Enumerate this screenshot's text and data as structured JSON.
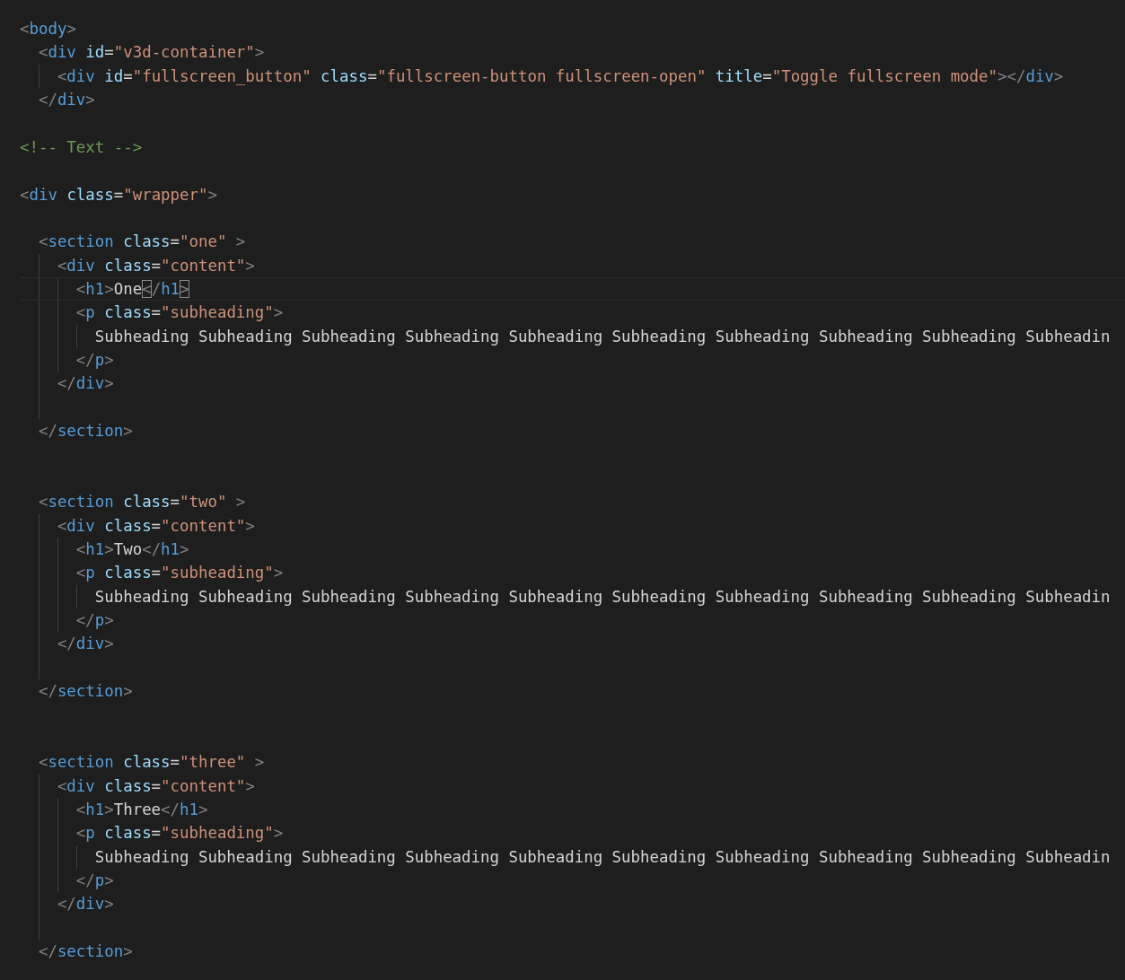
{
  "editor": {
    "lines": [
      {
        "kind": "code",
        "active": false,
        "tokens": [
          {
            "kind": "punct",
            "text": "<"
          },
          {
            "kind": "tag",
            "text": "body"
          },
          {
            "kind": "punct",
            "text": ">"
          }
        ]
      },
      {
        "kind": "code",
        "active": false,
        "tokens": [
          {
            "kind": "punct",
            "text": "  <"
          },
          {
            "kind": "tag",
            "text": "div"
          },
          {
            "kind": "attr",
            "text": " id"
          },
          {
            "kind": "text",
            "text": "="
          },
          {
            "kind": "string",
            "text": "\"v3d-container\""
          },
          {
            "kind": "punct",
            "text": ">"
          }
        ]
      },
      {
        "kind": "code",
        "active": false,
        "tokens": [
          {
            "kind": "punct",
            "text": "    <"
          },
          {
            "kind": "tag",
            "text": "div"
          },
          {
            "kind": "attr",
            "text": " id"
          },
          {
            "kind": "text",
            "text": "="
          },
          {
            "kind": "string",
            "text": "\"fullscreen_button\""
          },
          {
            "kind": "attr",
            "text": " class"
          },
          {
            "kind": "text",
            "text": "="
          },
          {
            "kind": "string",
            "text": "\"fullscreen-button fullscreen-open\""
          },
          {
            "kind": "attr",
            "text": " title"
          },
          {
            "kind": "text",
            "text": "="
          },
          {
            "kind": "string",
            "text": "\"Toggle fullscreen mode\""
          },
          {
            "kind": "punct",
            "text": "></"
          },
          {
            "kind": "tag",
            "text": "div"
          },
          {
            "kind": "punct",
            "text": ">"
          }
        ]
      },
      {
        "kind": "code",
        "active": false,
        "tokens": [
          {
            "kind": "punct",
            "text": "  </"
          },
          {
            "kind": "tag",
            "text": "div"
          },
          {
            "kind": "punct",
            "text": ">"
          }
        ]
      },
      {
        "kind": "blank",
        "active": false
      },
      {
        "kind": "code",
        "active": false,
        "tokens": [
          {
            "kind": "comment",
            "text": "<!-- Text -->"
          }
        ]
      },
      {
        "kind": "blank",
        "active": false
      },
      {
        "kind": "code",
        "active": false,
        "tokens": [
          {
            "kind": "punct",
            "text": "<"
          },
          {
            "kind": "tag",
            "text": "div"
          },
          {
            "kind": "attr",
            "text": " class"
          },
          {
            "kind": "text",
            "text": "="
          },
          {
            "kind": "string",
            "text": "\"wrapper\""
          },
          {
            "kind": "punct",
            "text": ">"
          }
        ]
      },
      {
        "kind": "blank",
        "active": false
      },
      {
        "kind": "code",
        "active": false,
        "tokens": [
          {
            "kind": "punct",
            "text": "  <"
          },
          {
            "kind": "tag",
            "text": "section"
          },
          {
            "kind": "attr",
            "text": " class"
          },
          {
            "kind": "text",
            "text": "="
          },
          {
            "kind": "string",
            "text": "\"one\""
          },
          {
            "kind": "punct",
            "text": " >"
          }
        ]
      },
      {
        "kind": "code",
        "active": false,
        "tokens": [
          {
            "kind": "punct",
            "text": "    <"
          },
          {
            "kind": "tag",
            "text": "div"
          },
          {
            "kind": "attr",
            "text": " class"
          },
          {
            "kind": "text",
            "text": "="
          },
          {
            "kind": "string",
            "text": "\"content\""
          },
          {
            "kind": "punct",
            "text": ">"
          }
        ]
      },
      {
        "kind": "code",
        "active": true,
        "tokens": [
          {
            "kind": "punct",
            "text": "      <"
          },
          {
            "kind": "tag",
            "text": "h1"
          },
          {
            "kind": "punct",
            "text": ">"
          },
          {
            "kind": "text",
            "text": "One"
          },
          {
            "kind": "bracket-match",
            "text": "<"
          },
          {
            "kind": "punct",
            "text": "/"
          },
          {
            "kind": "tag",
            "text": "h1"
          },
          {
            "kind": "bracket-match",
            "text": ">"
          }
        ]
      },
      {
        "kind": "code",
        "active": false,
        "tokens": [
          {
            "kind": "punct",
            "text": "      <"
          },
          {
            "kind": "tag",
            "text": "p"
          },
          {
            "kind": "attr",
            "text": " class"
          },
          {
            "kind": "text",
            "text": "="
          },
          {
            "kind": "string",
            "text": "\"subheading\""
          },
          {
            "kind": "punct",
            "text": ">"
          }
        ]
      },
      {
        "kind": "code",
        "active": false,
        "tokens": [
          {
            "kind": "text",
            "text": "        Subheading Subheading Subheading Subheading Subheading Subheading Subheading Subheading Subheading Subheadin"
          }
        ]
      },
      {
        "kind": "code",
        "active": false,
        "tokens": [
          {
            "kind": "punct",
            "text": "      </"
          },
          {
            "kind": "tag",
            "text": "p"
          },
          {
            "kind": "punct",
            "text": ">"
          }
        ]
      },
      {
        "kind": "code",
        "active": false,
        "tokens": [
          {
            "kind": "punct",
            "text": "    </"
          },
          {
            "kind": "tag",
            "text": "div"
          },
          {
            "kind": "punct",
            "text": ">"
          }
        ]
      },
      {
        "kind": "blank-guide",
        "active": false
      },
      {
        "kind": "code",
        "active": false,
        "tokens": [
          {
            "kind": "punct",
            "text": "  </"
          },
          {
            "kind": "tag",
            "text": "section"
          },
          {
            "kind": "punct",
            "text": ">"
          }
        ]
      },
      {
        "kind": "blank",
        "active": false
      },
      {
        "kind": "blank",
        "active": false
      },
      {
        "kind": "code",
        "active": false,
        "tokens": [
          {
            "kind": "punct",
            "text": "  <"
          },
          {
            "kind": "tag",
            "text": "section"
          },
          {
            "kind": "attr",
            "text": " class"
          },
          {
            "kind": "text",
            "text": "="
          },
          {
            "kind": "string",
            "text": "\"two\""
          },
          {
            "kind": "punct",
            "text": " >"
          }
        ]
      },
      {
        "kind": "code",
        "active": false,
        "tokens": [
          {
            "kind": "punct",
            "text": "    <"
          },
          {
            "kind": "tag",
            "text": "div"
          },
          {
            "kind": "attr",
            "text": " class"
          },
          {
            "kind": "text",
            "text": "="
          },
          {
            "kind": "string",
            "text": "\"content\""
          },
          {
            "kind": "punct",
            "text": ">"
          }
        ]
      },
      {
        "kind": "code",
        "active": false,
        "tokens": [
          {
            "kind": "punct",
            "text": "      <"
          },
          {
            "kind": "tag",
            "text": "h1"
          },
          {
            "kind": "punct",
            "text": ">"
          },
          {
            "kind": "text",
            "text": "Two"
          },
          {
            "kind": "punct",
            "text": "</"
          },
          {
            "kind": "tag",
            "text": "h1"
          },
          {
            "kind": "punct",
            "text": ">"
          }
        ]
      },
      {
        "kind": "code",
        "active": false,
        "tokens": [
          {
            "kind": "punct",
            "text": "      <"
          },
          {
            "kind": "tag",
            "text": "p"
          },
          {
            "kind": "attr",
            "text": " class"
          },
          {
            "kind": "text",
            "text": "="
          },
          {
            "kind": "string",
            "text": "\"subheading\""
          },
          {
            "kind": "punct",
            "text": ">"
          }
        ]
      },
      {
        "kind": "code",
        "active": false,
        "tokens": [
          {
            "kind": "text",
            "text": "        Subheading Subheading Subheading Subheading Subheading Subheading Subheading Subheading Subheading Subheadin"
          }
        ]
      },
      {
        "kind": "code",
        "active": false,
        "tokens": [
          {
            "kind": "punct",
            "text": "      </"
          },
          {
            "kind": "tag",
            "text": "p"
          },
          {
            "kind": "punct",
            "text": ">"
          }
        ]
      },
      {
        "kind": "code",
        "active": false,
        "tokens": [
          {
            "kind": "punct",
            "text": "    </"
          },
          {
            "kind": "tag",
            "text": "div"
          },
          {
            "kind": "punct",
            "text": ">"
          }
        ]
      },
      {
        "kind": "blank-guide",
        "active": false
      },
      {
        "kind": "code",
        "active": false,
        "tokens": [
          {
            "kind": "punct",
            "text": "  </"
          },
          {
            "kind": "tag",
            "text": "section"
          },
          {
            "kind": "punct",
            "text": ">"
          }
        ]
      },
      {
        "kind": "blank",
        "active": false
      },
      {
        "kind": "blank",
        "active": false
      },
      {
        "kind": "code",
        "active": false,
        "tokens": [
          {
            "kind": "punct",
            "text": "  <"
          },
          {
            "kind": "tag",
            "text": "section"
          },
          {
            "kind": "attr",
            "text": " class"
          },
          {
            "kind": "text",
            "text": "="
          },
          {
            "kind": "string",
            "text": "\"three\""
          },
          {
            "kind": "punct",
            "text": " >"
          }
        ]
      },
      {
        "kind": "code",
        "active": false,
        "tokens": [
          {
            "kind": "punct",
            "text": "    <"
          },
          {
            "kind": "tag",
            "text": "div"
          },
          {
            "kind": "attr",
            "text": " class"
          },
          {
            "kind": "text",
            "text": "="
          },
          {
            "kind": "string",
            "text": "\"content\""
          },
          {
            "kind": "punct",
            "text": ">"
          }
        ]
      },
      {
        "kind": "code",
        "active": false,
        "tokens": [
          {
            "kind": "punct",
            "text": "      <"
          },
          {
            "kind": "tag",
            "text": "h1"
          },
          {
            "kind": "punct",
            "text": ">"
          },
          {
            "kind": "text",
            "text": "Three"
          },
          {
            "kind": "punct",
            "text": "</"
          },
          {
            "kind": "tag",
            "text": "h1"
          },
          {
            "kind": "punct",
            "text": ">"
          }
        ]
      },
      {
        "kind": "code",
        "active": false,
        "tokens": [
          {
            "kind": "punct",
            "text": "      <"
          },
          {
            "kind": "tag",
            "text": "p"
          },
          {
            "kind": "attr",
            "text": " class"
          },
          {
            "kind": "text",
            "text": "="
          },
          {
            "kind": "string",
            "text": "\"subheading\""
          },
          {
            "kind": "punct",
            "text": ">"
          }
        ]
      },
      {
        "kind": "code",
        "active": false,
        "tokens": [
          {
            "kind": "text",
            "text": "        Subheading Subheading Subheading Subheading Subheading Subheading Subheading Subheading Subheading Subheadin"
          }
        ]
      },
      {
        "kind": "code",
        "active": false,
        "tokens": [
          {
            "kind": "punct",
            "text": "      </"
          },
          {
            "kind": "tag",
            "text": "p"
          },
          {
            "kind": "punct",
            "text": ">"
          }
        ]
      },
      {
        "kind": "code",
        "active": false,
        "tokens": [
          {
            "kind": "punct",
            "text": "    </"
          },
          {
            "kind": "tag",
            "text": "div"
          },
          {
            "kind": "punct",
            "text": ">"
          }
        ]
      },
      {
        "kind": "blank-guide",
        "active": false
      },
      {
        "kind": "code",
        "active": false,
        "tokens": [
          {
            "kind": "punct",
            "text": "  </"
          },
          {
            "kind": "tag",
            "text": "section"
          },
          {
            "kind": "punct",
            "text": ">"
          }
        ]
      }
    ]
  }
}
